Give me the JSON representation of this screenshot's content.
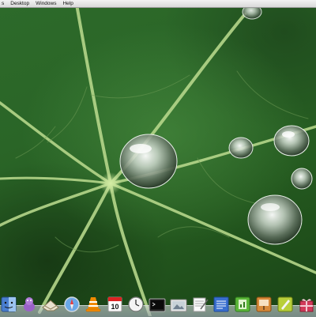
{
  "menubar": {
    "items": [
      "s",
      "Desktop",
      "Windows",
      "Help"
    ]
  },
  "dock": {
    "items": [
      {
        "name": "finder-icon"
      },
      {
        "name": "imagination-icon"
      },
      {
        "name": "mail-icon"
      },
      {
        "name": "safari-icon"
      },
      {
        "name": "vlc-icon"
      },
      {
        "name": "calendar-icon",
        "day": "10"
      },
      {
        "name": "clock-icon"
      },
      {
        "name": "terminal-icon"
      },
      {
        "name": "preview-icon"
      },
      {
        "name": "textedit-icon"
      },
      {
        "name": "document-icon"
      },
      {
        "name": "numbers-icon"
      },
      {
        "name": "keynote-icon"
      },
      {
        "name": "pages-icon"
      },
      {
        "name": "gift-icon"
      }
    ]
  },
  "colors": {
    "leaf_green": "#2a6527",
    "vein": "#b8d98a",
    "menubar": "#e6e6e6"
  }
}
